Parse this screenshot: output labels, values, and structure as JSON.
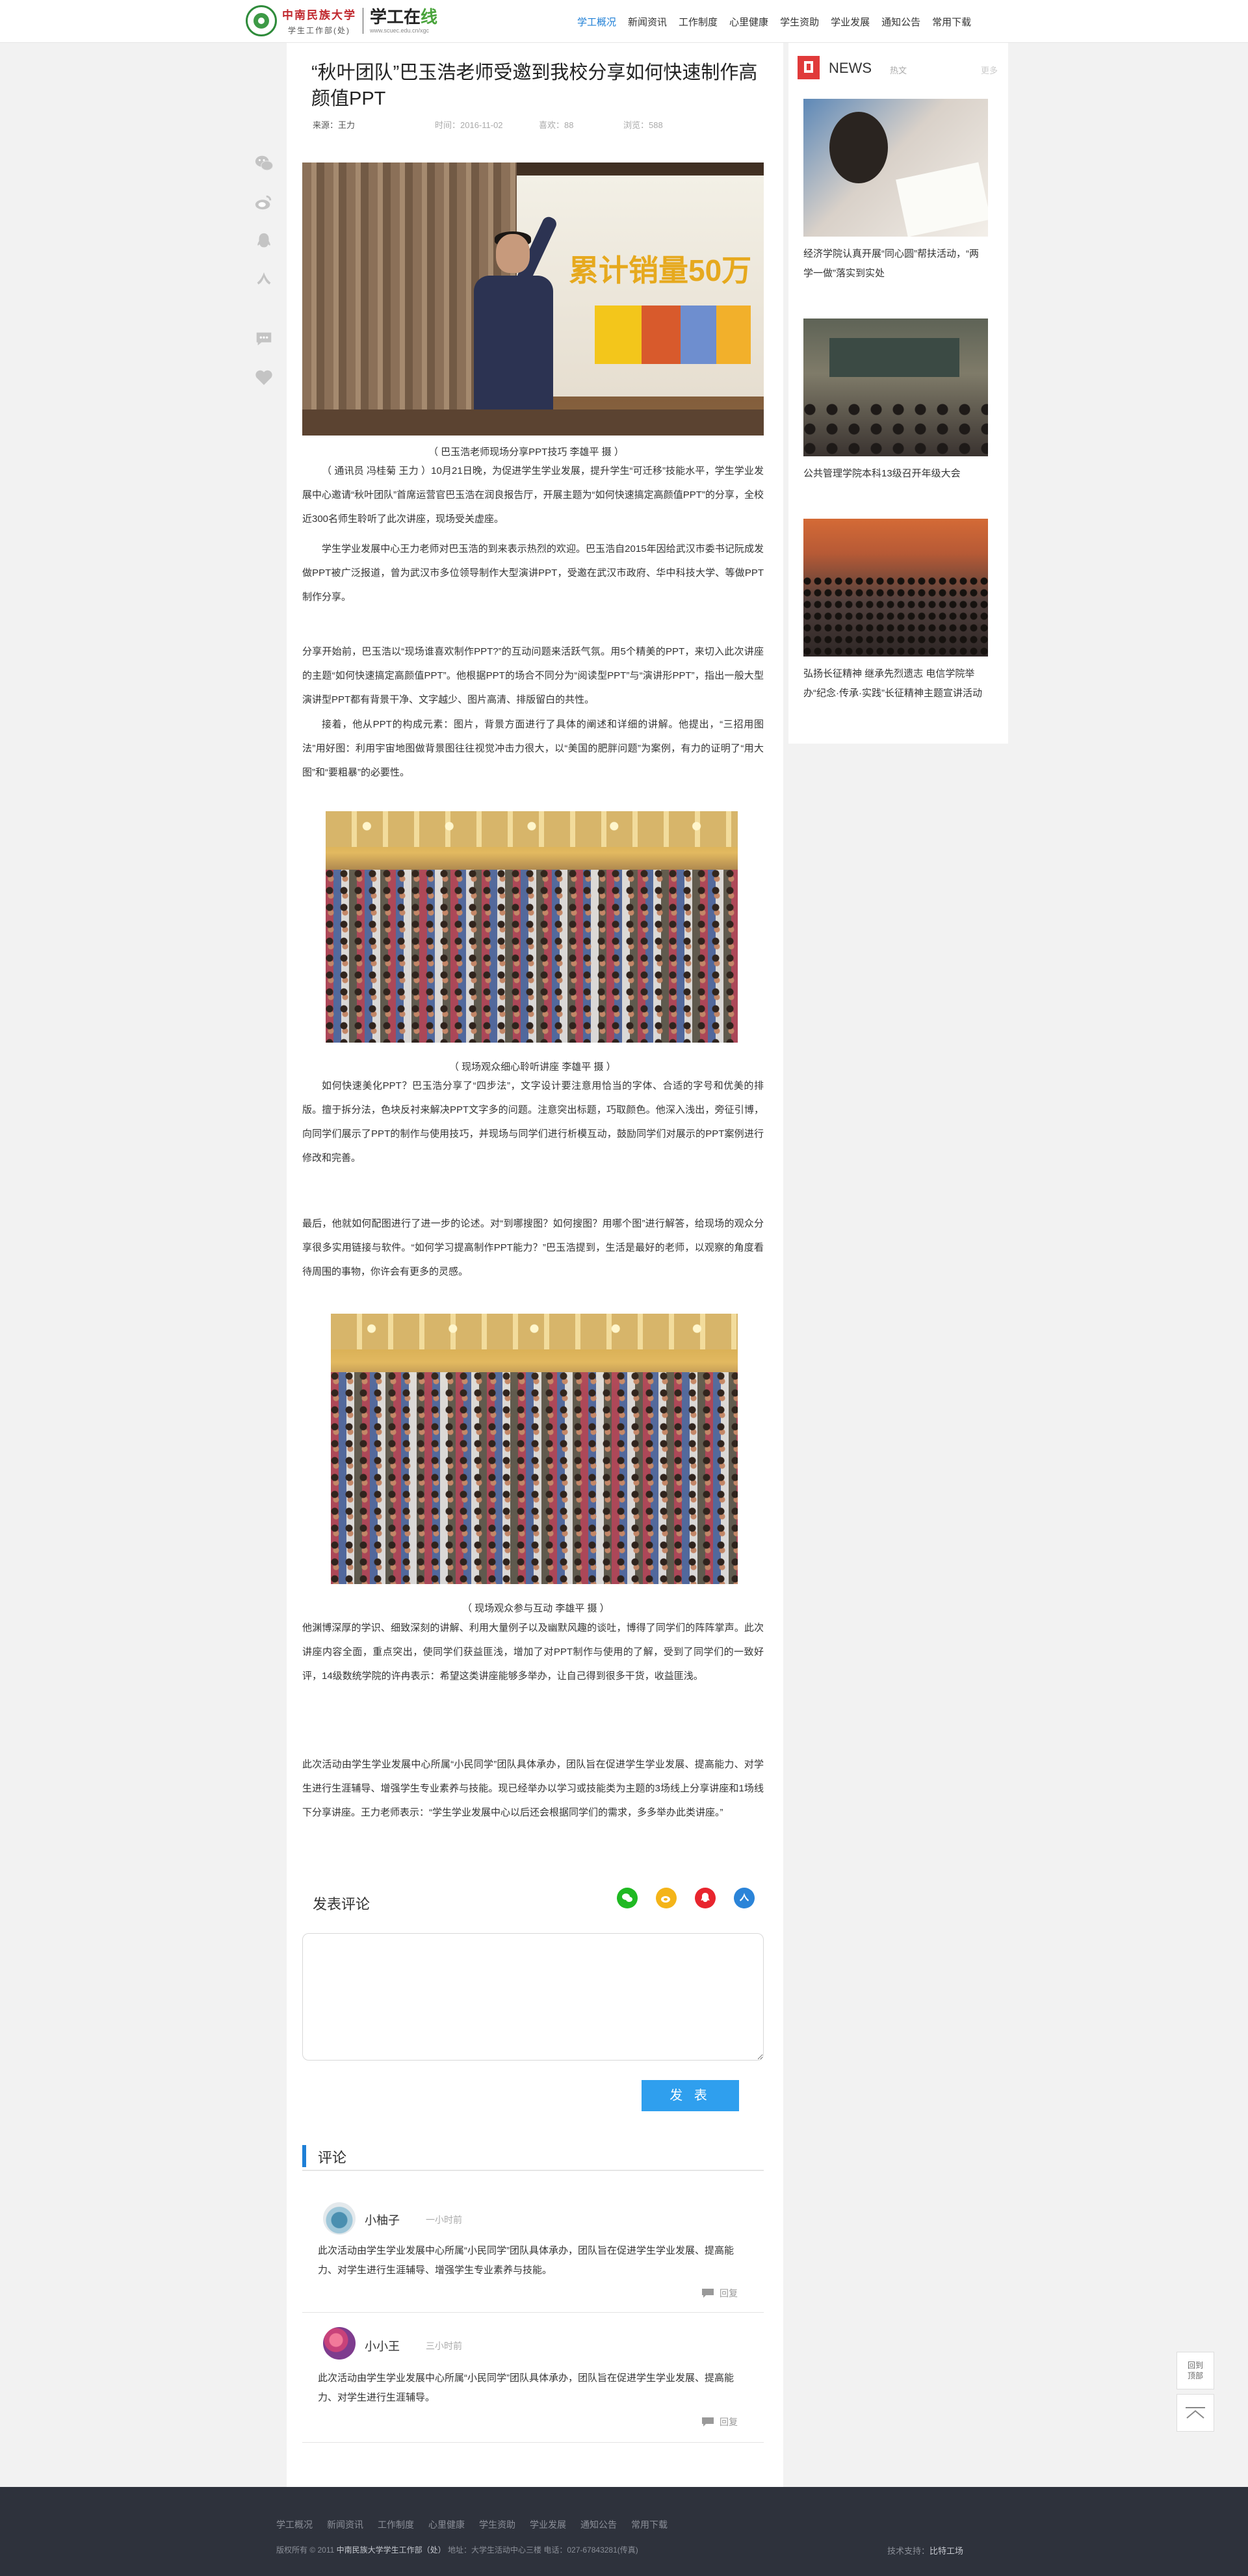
{
  "header": {
    "logo_text": "中南民族大学",
    "logo_sub": "学生工作部(处)",
    "brand": "学工在",
    "brand_accent": "线",
    "brand_url": "www.scuec.edu.cn/xgc",
    "nav": [
      "学工概况",
      "新闻资讯",
      "工作制度",
      "心里健康",
      "学生资助",
      "学业发展",
      "通知公告",
      "常用下载"
    ],
    "active_nav": "学工概况"
  },
  "article": {
    "title": "“秋叶团队”巴玉浩老师受邀到我校分享如何快速制作高颜值PPT",
    "source": "来源：王力",
    "time": "时间：2016-11-02",
    "likes": "喜欢：88",
    "views": "浏览：588",
    "photo1_screen_text": "累计销量50万",
    "caption1": "（ 巴玉浩老师现场分享PPT技巧 李雄平 摄 ）",
    "p1": "（ 通讯员 冯桂菊 王力 ）10月21日晚，为促进学生学业发展，提升学生“可迁移”技能水平，学生学业发展中心邀请“秋叶团队”首席运营官巴玉浩在润良报告厅，开展主题为“如何快速搞定高颜值PPT”的分享，全校近300名师生聆听了此次讲座，现场受关虚座。",
    "p2": "学生学业发展中心王力老师对巴玉浩的到来表示热烈的欢迎。巴玉浩自2015年因给武汉市委书记阮成发做PPT被广泛报道，曾为武汉市多位领导制作大型演讲PPT，受邀在武汉市政府、华中科技大学、等做PPT制作分享。",
    "p3": "分享开始前，巴玉浩以“现场谁喜欢制作PPT?”的互动问题来活跃气氛。用5个精美的PPT，来切入此次讲座的主题“如何快速搞定高颜值PPT”。他根据PPT的场合不同分为“阅读型PPT”与“演讲形PPT”，指出一般大型演讲型PPT都有背景干净、文字越少、图片高清、排版留白的共性。",
    "p4": "接着，他从PPT的构成元素：图片，背景方面进行了具体的阐述和详细的讲解。他提出，“三招用图法”用好图：利用宇宙地图做背景图往往视觉冲击力很大，以“美国的肥胖问题”为案例，有力的证明了“用大图”和“要粗暴”的必要性。",
    "caption2": "（ 现场观众细心聆听讲座 李雄平 摄 ）",
    "p5": "如何快速美化PPT？巴玉浩分享了“四步法”，文字设计要注意用恰当的字体、合适的字号和优美的排版。擅于拆分法，色块反衬来解决PPT文字多的问题。注意突出标题，巧取颜色。他深入浅出，旁征引博，向同学们展示了PPT的制作与使用技巧，并现场与同学们进行析模互动，鼓励同学们对展示的PPT案例进行修改和完善。",
    "p6": "最后，他就如何配图进行了进一步的论述。对“到哪搜图？如何搜图？用哪个图”进行解答，给现场的观众分享很多实用链接与软件。“如何学习提高制作PPT能力？”巴玉浩提到，生活是最好的老师，以观察的角度看待周围的事物，你许会有更多的灵感。",
    "caption3": "（ 现场观众参与互动 李雄平 摄 ）",
    "p7": "他渊博深厚的学识、细致深刻的讲解、利用大量例子以及幽默风趣的谈吐，博得了同学们的阵阵掌声。此次讲座内容全面，重点突出，使同学们获益匪浅，增加了对PPT制作与使用的了解，受到了同学们的一致好评，14级数统学院的许冉表示：希望这类讲座能够多举办，让自己得到很多干货，收益匪浅。",
    "p8": "此次活动由学生学业发展中心所属“小民同学”团队具体承办，团队旨在促进学生学业发展、提高能力、对学生进行生涯辅导、增强学生专业素养与技能。现已经举办以学习或技能类为主题的3场线上分享讲座和1场线下分享讲座。王力老师表示：“学生学业发展中心以后还会根据同学们的需求，多多举办此类讲座。”"
  },
  "share_side": [
    "wechat-icon",
    "weibo-icon",
    "qq-icon",
    "renren-icon",
    "comment-icon",
    "heart-icon"
  ],
  "comment_form": {
    "heading": "发表评论",
    "placeholder": "",
    "submit": "发 表",
    "share_colors": [
      "#1fb922",
      "#f4b419",
      "#e8252e",
      "#2b84d8"
    ]
  },
  "comments": {
    "heading": "评论",
    "items": [
      {
        "name": "小柚子",
        "time": "一小时前",
        "text": "此次活动由学生学业发展中心所属“小民同学”团队具体承办，团队旨在促进学生学业发展、提高能力、对学生进行生涯辅导、增强学生专业素养与技能。",
        "reply": "回复"
      },
      {
        "name": "小小王",
        "time": "三小时前",
        "text": "此次活动由学生学业发展中心所属“小民同学”团队具体承办，团队旨在促进学生学业发展、提高能力、对学生进行生涯辅导。",
        "reply": "回复"
      }
    ]
  },
  "sidebar": {
    "title": "NEWS",
    "subtitle": "热文",
    "more": "更多",
    "items": [
      {
        "caption": "经济学院认真开展“同心圆”帮扶活动，“两学一做”落实到实处"
      },
      {
        "caption": "公共管理学院本科13级召开年级大会"
      },
      {
        "caption": "弘扬长征精神 继承先烈遗志 电信学院举办“纪念·传承·实践”长征精神主题宣讲活动"
      }
    ]
  },
  "float": {
    "back_label": "回到\n顶部"
  },
  "footer": {
    "nav": [
      "学工概况",
      "新闻资讯",
      "工作制度",
      "心里健康",
      "学生资助",
      "学业发展",
      "通知公告",
      "常用下载"
    ],
    "copyright_pre": "版权所有 © 2011",
    "copyright_org": "中南民族大学学生工作部（处）",
    "copyright_post": "地址：大学生活动中心三楼  电话：027-67843281(传真)",
    "tech_pre": "技术支持：",
    "tech_org": "比特工场"
  }
}
